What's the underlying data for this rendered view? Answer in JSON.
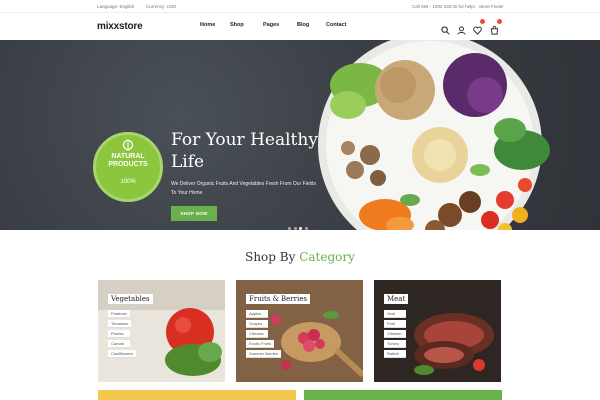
{
  "topbar": {
    "language": "Language: English",
    "currency": "Currency: USD",
    "call": "Call 084 - 1000 333 00 for help!",
    "store_finder": "Store Finder"
  },
  "header": {
    "logo": "mixxstore",
    "nav": [
      {
        "label": "Home"
      },
      {
        "label": "Shop"
      },
      {
        "label": "Pages"
      },
      {
        "label": "Blog"
      },
      {
        "label": "Contact"
      }
    ],
    "icons": [
      "search-icon",
      "user-icon",
      "heart-icon",
      "cart-icon"
    ]
  },
  "hero": {
    "badge_line1": "NATURAL",
    "badge_line2": "PRODUCTS",
    "badge_pct": "100%",
    "title": "For Your Healthy Life",
    "subtitle": "We Deliver Organic Fruits And Vegetables Fresh From Our Fields To Your Home",
    "button": "SHOP NOW",
    "slides": 4,
    "active_slide": 1
  },
  "section": {
    "title_prefix": "Shop By",
    "title_accent": "Category"
  },
  "categories": [
    {
      "title": "Vegetables",
      "items": [
        "Potatoes",
        "Tomatoes",
        "Pickles",
        "Carrots",
        "Cauliflowers"
      ]
    },
    {
      "title": "Fruits & Berries",
      "items": [
        "Apples",
        "Grapes",
        "Citruses",
        "Exotic Fruits",
        "Summer Berries"
      ]
    },
    {
      "title": "Meat",
      "items": [
        "Veal",
        "Pork",
        "Chicken",
        "Turkey",
        "Rabbit"
      ]
    }
  ],
  "colors": {
    "accent": "#6ab04c",
    "badge": "#8cc63f",
    "hero_bg": "#3c4147",
    "notification": "#e74c3c"
  }
}
